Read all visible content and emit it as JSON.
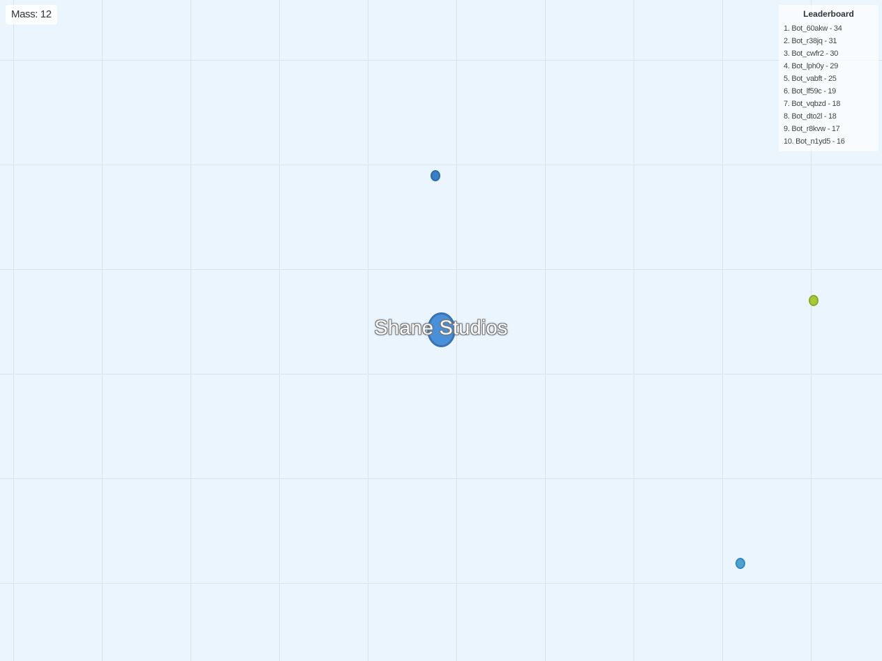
{
  "hud": {
    "mass_label": "Mass: 12"
  },
  "player": {
    "name": "Shane Studios",
    "color": "#4a90d9"
  },
  "leaderboard": {
    "title": "Leaderboard",
    "entries": [
      "1. Bot_60akw - 34",
      "2. Bot_r38jq - 31",
      "3. Bot_cwfr2 - 30",
      "4. Bot_lph0y - 29",
      "5. Bot_vabft - 25",
      "6. Bot_lf59c - 19",
      "7. Bot_vqbzd - 18",
      "8. Bot_dto2l - 18",
      "9. Bot_r8kvw - 17",
      "10. Bot_n1yd5 - 16"
    ]
  },
  "colors": {
    "background": "#ebf5fe",
    "grid": "#d9e3ec",
    "pellet_blue_dark": "#3a7fc4",
    "pellet_yellow_green": "#a8c83a",
    "pellet_cyan": "#4aa3d4"
  }
}
